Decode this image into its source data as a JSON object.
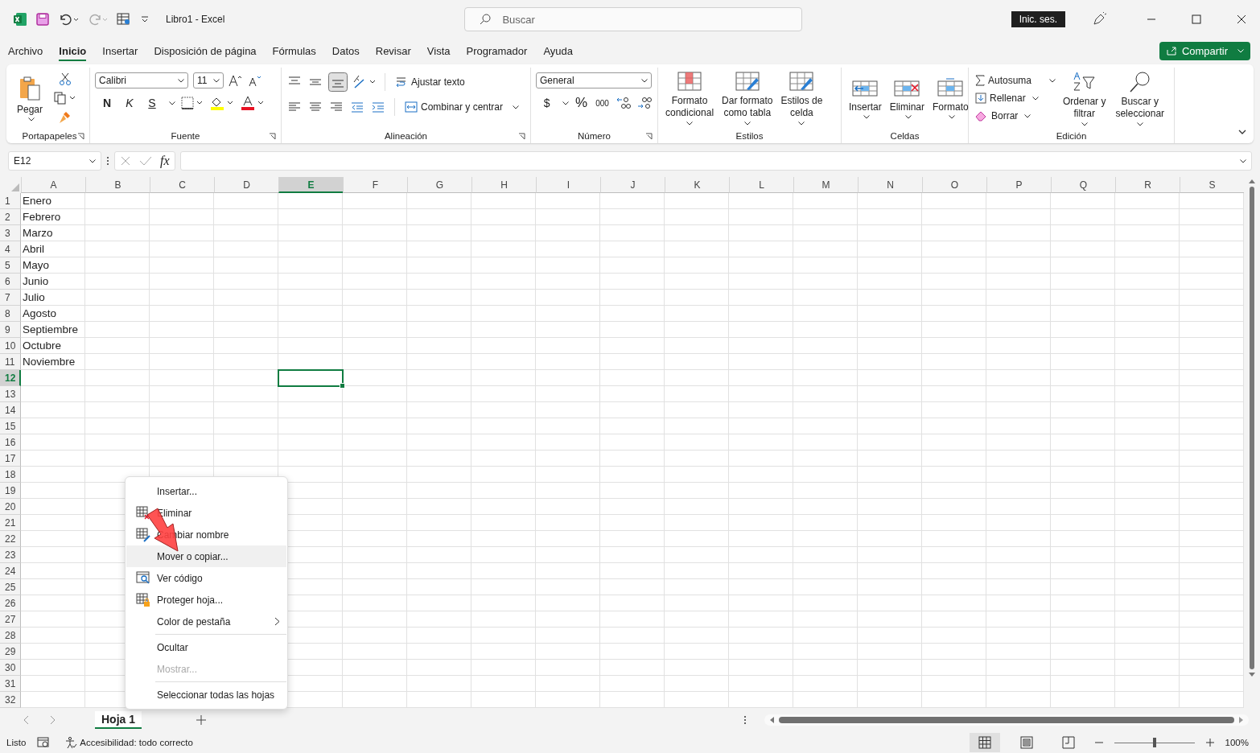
{
  "window": {
    "title": "Libro1  -  Excel",
    "search_placeholder": "Buscar",
    "sign_in": "Inic. ses."
  },
  "menu_tabs": [
    {
      "label": "Archivo",
      "selected": false
    },
    {
      "label": "Inicio",
      "selected": true
    },
    {
      "label": "Insertar",
      "selected": false
    },
    {
      "label": "Disposición de página",
      "selected": false
    },
    {
      "label": "Fórmulas",
      "selected": false
    },
    {
      "label": "Datos",
      "selected": false
    },
    {
      "label": "Revisar",
      "selected": false
    },
    {
      "label": "Vista",
      "selected": false
    },
    {
      "label": "Programador",
      "selected": false
    },
    {
      "label": "Ayuda",
      "selected": false
    }
  ],
  "share_button": "Compartir",
  "ribbon": {
    "clipboard": {
      "paste": "Pegar",
      "group": "Portapapeles"
    },
    "font": {
      "family": "Calibri",
      "size": "11",
      "bold": "N",
      "italic": "K",
      "underline": "S",
      "group": "Fuente"
    },
    "alignment": {
      "wrap": "Ajustar texto",
      "merge": "Combinar y centrar",
      "group": "Alineación",
      "bottom_align_selected": true
    },
    "number": {
      "format": "General",
      "currency": "$",
      "percent": "%",
      "thousands": "000",
      "group": "Número"
    },
    "styles": {
      "buttons": [
        "Formato\ncondicional",
        "Dar formato\ncomo tabla",
        "Estilos de\ncelda"
      ],
      "group": "Estilos"
    },
    "cells": {
      "buttons": [
        "Insertar",
        "Eliminar",
        "Formato"
      ],
      "group": "Celdas"
    },
    "editing": {
      "autosum": "Autosuma",
      "fill": "Rellenar",
      "clear": "Borrar",
      "sort": "Ordenar y\nfiltrar",
      "find": "Buscar y\nseleccionar",
      "group": "Edición"
    }
  },
  "formula_bar": {
    "name_box": "E12",
    "fx": "fx"
  },
  "sheet": {
    "columns": [
      {
        "label": "A",
        "selected": false
      },
      {
        "label": "B",
        "selected": false
      },
      {
        "label": "C",
        "selected": false
      },
      {
        "label": "D",
        "selected": false
      },
      {
        "label": "E",
        "selected": true
      },
      {
        "label": "F",
        "selected": false
      },
      {
        "label": "G",
        "selected": false
      },
      {
        "label": "H",
        "selected": false
      },
      {
        "label": "I",
        "selected": false
      },
      {
        "label": "J",
        "selected": false
      },
      {
        "label": "K",
        "selected": false
      },
      {
        "label": "L",
        "selected": false
      },
      {
        "label": "M",
        "selected": false
      },
      {
        "label": "N",
        "selected": false
      },
      {
        "label": "O",
        "selected": false
      },
      {
        "label": "P",
        "selected": false
      },
      {
        "label": "Q",
        "selected": false
      },
      {
        "label": "R",
        "selected": false
      },
      {
        "label": "S",
        "selected": false
      }
    ],
    "rows": [
      {
        "number": "1",
        "selected": false,
        "cells": [
          "Enero"
        ]
      },
      {
        "number": "2",
        "selected": false,
        "cells": [
          "Febrero"
        ]
      },
      {
        "number": "3",
        "selected": false,
        "cells": [
          "Marzo"
        ]
      },
      {
        "number": "4",
        "selected": false,
        "cells": [
          "Abril"
        ]
      },
      {
        "number": "5",
        "selected": false,
        "cells": [
          "Mayo"
        ]
      },
      {
        "number": "6",
        "selected": false,
        "cells": [
          "Junio"
        ]
      },
      {
        "number": "7",
        "selected": false,
        "cells": [
          "Julio"
        ]
      },
      {
        "number": "8",
        "selected": false,
        "cells": [
          "Agosto"
        ]
      },
      {
        "number": "9",
        "selected": false,
        "cells": [
          "Septiembre"
        ]
      },
      {
        "number": "10",
        "selected": false,
        "cells": [
          "Octubre"
        ]
      },
      {
        "number": "11",
        "selected": false,
        "cells": [
          "Noviembre"
        ]
      },
      {
        "number": "12",
        "selected": true,
        "cells": []
      },
      {
        "number": "13",
        "selected": false,
        "cells": []
      },
      {
        "number": "14",
        "selected": false,
        "cells": []
      },
      {
        "number": "15",
        "selected": false,
        "cells": []
      },
      {
        "number": "16",
        "selected": false,
        "cells": []
      },
      {
        "number": "17",
        "selected": false,
        "cells": []
      },
      {
        "number": "18",
        "selected": false,
        "cells": []
      },
      {
        "number": "19",
        "selected": false,
        "cells": []
      },
      {
        "number": "20",
        "selected": false,
        "cells": []
      },
      {
        "number": "21",
        "selected": false,
        "cells": []
      },
      {
        "number": "22",
        "selected": false,
        "cells": []
      },
      {
        "number": "23",
        "selected": false,
        "cells": []
      },
      {
        "number": "24",
        "selected": false,
        "cells": []
      },
      {
        "number": "25",
        "selected": false,
        "cells": []
      },
      {
        "number": "26",
        "selected": false,
        "cells": []
      },
      {
        "number": "27",
        "selected": false,
        "cells": []
      },
      {
        "number": "28",
        "selected": false,
        "cells": []
      },
      {
        "number": "29",
        "selected": false,
        "cells": []
      },
      {
        "number": "30",
        "selected": false,
        "cells": []
      },
      {
        "number": "31",
        "selected": false,
        "cells": []
      },
      {
        "number": "32",
        "selected": false,
        "cells": []
      }
    ]
  },
  "context_menu": [
    {
      "kind": "item",
      "label": "Insertar...",
      "selected": false,
      "disabled": false,
      "submenu": false
    },
    {
      "kind": "item",
      "label": "Eliminar",
      "selected": false,
      "disabled": false,
      "submenu": false
    },
    {
      "kind": "item",
      "label": "Cambiar nombre",
      "selected": false,
      "disabled": false,
      "submenu": false
    },
    {
      "kind": "item",
      "label": "Mover o copiar...",
      "selected": true,
      "disabled": false,
      "submenu": false
    },
    {
      "kind": "item",
      "label": "Ver código",
      "selected": false,
      "disabled": false,
      "submenu": false
    },
    {
      "kind": "item",
      "label": "Proteger hoja...",
      "selected": false,
      "disabled": false,
      "submenu": false
    },
    {
      "kind": "item",
      "label": "Color de pestaña",
      "selected": false,
      "disabled": false,
      "submenu": true
    },
    {
      "kind": "separator"
    },
    {
      "kind": "item",
      "label": "Ocultar",
      "selected": false,
      "disabled": false,
      "submenu": false
    },
    {
      "kind": "item",
      "label": "Mostrar...",
      "selected": false,
      "disabled": true,
      "submenu": false
    },
    {
      "kind": "separator"
    },
    {
      "kind": "item",
      "label": "Seleccionar todas las hojas",
      "selected": false,
      "disabled": false,
      "submenu": false
    }
  ],
  "sheet_tabs": [
    {
      "label": "Hoja 1",
      "selected": true
    }
  ],
  "status_bar": {
    "ready": "Listo",
    "accessibility": "Accesibilidad: todo correcto",
    "views": [
      {
        "selected": true
      },
      {
        "selected": false
      },
      {
        "selected": false
      }
    ],
    "zoom": {
      "level": 0.5,
      "reading": "100%"
    }
  }
}
